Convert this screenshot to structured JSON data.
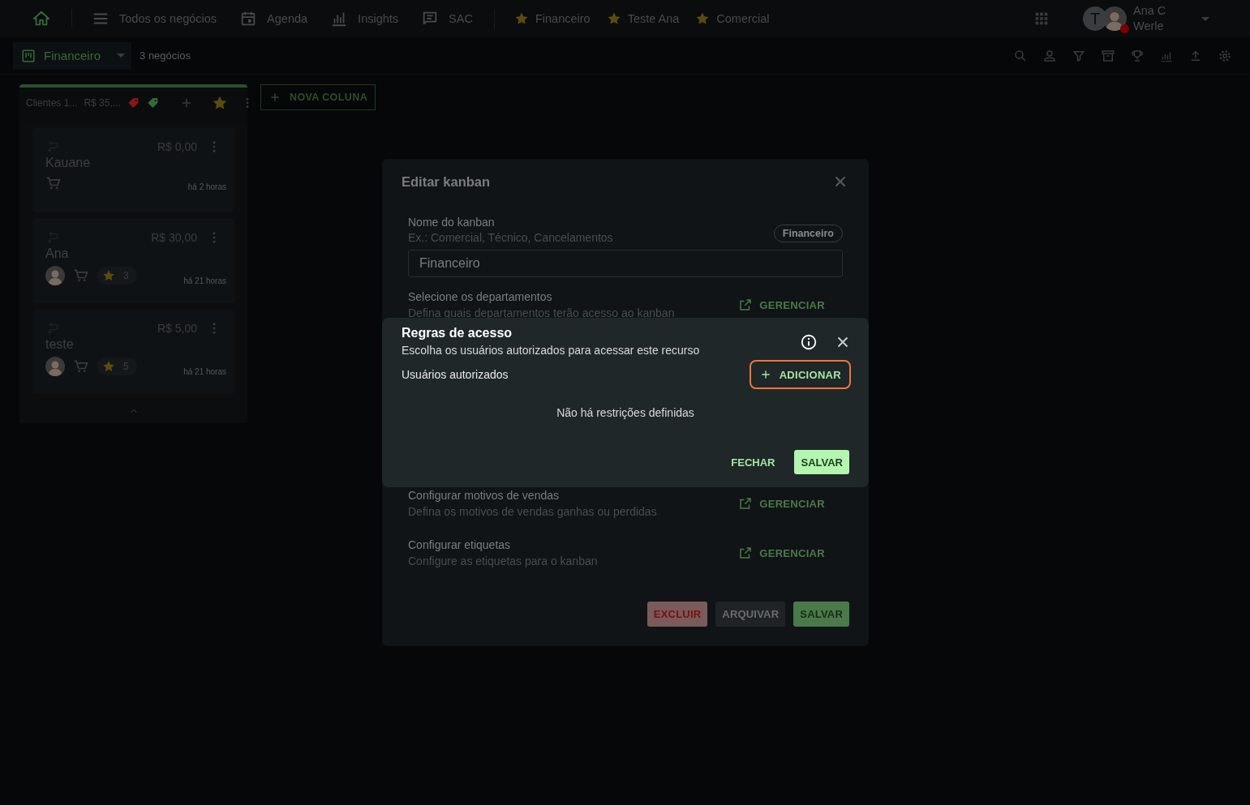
{
  "nav": {
    "items": [
      {
        "kind": "home",
        "selected": true
      },
      {
        "kind": "menu",
        "label": "Todos os negócios",
        "selected": false
      },
      {
        "kind": "calendar",
        "label": "Agenda",
        "selected": false
      },
      {
        "kind": "chart",
        "label": "Insights",
        "selected": false
      },
      {
        "kind": "chat",
        "label": "SAC",
        "selected": false
      }
    ],
    "favorites": [
      {
        "label": "Financeiro"
      },
      {
        "label": "Teste Ana"
      },
      {
        "label": "Comercial"
      }
    ],
    "user": {
      "initial": "T",
      "name": "Ana C",
      "surname": "Werle",
      "unavailable": true
    }
  },
  "toolbar": {
    "board": "Financeiro",
    "count": "3 negócios"
  },
  "board": {
    "column": {
      "title": "Clientes 1...",
      "total": "R$ 35,...",
      "tags": [
        {
          "color": "#8a1616"
        },
        {
          "color": "#356a35"
        }
      ],
      "cards": [
        {
          "value": "R$ 0,00",
          "title": "Kauane",
          "time": "há 2 horas",
          "avatar": false
        },
        {
          "value": "R$ 30,00",
          "title": "Ana",
          "time": "há 21 horas",
          "avatar": true,
          "score": "3"
        },
        {
          "value": "R$ 5,00",
          "title": "teste",
          "time": "há 21 horas",
          "avatar": true,
          "score": "5"
        }
      ]
    },
    "new_column": "NOVA COLUNA"
  },
  "edit_dialog": {
    "title": "Editar kanban",
    "name_label": "Nome do kanban",
    "name_hint": "Ex.: Comercial, Técnico, Cancelamentos",
    "chip": "Financeiro",
    "name_value": "Financeiro",
    "sections": [
      {
        "title": "Selecione os departamentos",
        "description": "Defina quais departamentos terão acesso ao kanban",
        "action": "GERENCIAR"
      },
      {
        "title": "Configurar motivos de vendas",
        "description": "Defina os motivos de vendas ganhas ou perdidas",
        "action": "GERENCIAR"
      },
      {
        "title": "Configurar etiquetas",
        "description": "Configure as etiquetas para o kanban",
        "action": "GERENCIAR"
      }
    ],
    "buttons": [
      {
        "label": "EXCLUIR",
        "kind": "danger"
      },
      {
        "label": "ARQUIVAR",
        "kind": "neutral"
      },
      {
        "label": "SALVAR",
        "kind": "primary"
      }
    ]
  },
  "access_dialog": {
    "title": "Regras de acesso",
    "subtitle": "Escolha os usuários autorizados para acessar este recurso",
    "users_label": "Usuários autorizados",
    "add_button": {
      "label": "ADICIONAR",
      "focused": true
    },
    "empty": "Não há restrições definidas",
    "buttons": [
      {
        "label": "FECHAR",
        "kind": "text"
      },
      {
        "label": "SALVAR",
        "kind": "primary"
      }
    ]
  }
}
